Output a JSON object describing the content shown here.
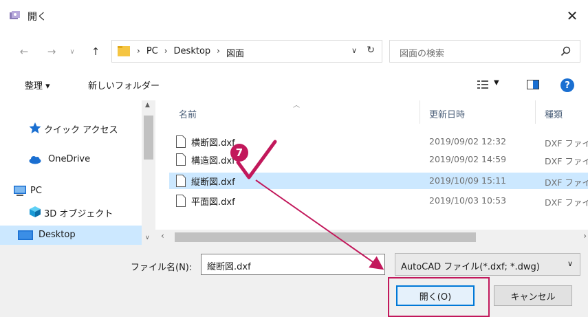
{
  "window": {
    "title": "開く"
  },
  "address": {
    "crumbs": [
      "PC",
      "Desktop",
      "図面"
    ],
    "search_placeholder": "図面の検索"
  },
  "toolbar": {
    "organize": "整理 ▾",
    "new_folder": "新しいフォルダー"
  },
  "sidebar": {
    "items": [
      {
        "label": "クイック アクセス",
        "icon": "star-icon"
      },
      {
        "label": "OneDrive",
        "icon": "cloud-icon"
      },
      {
        "label": "PC",
        "icon": "computer-icon"
      },
      {
        "label": "3D オブジェクト",
        "icon": "cube-icon"
      },
      {
        "label": "Desktop",
        "icon": "desktop-icon",
        "selected": true
      }
    ]
  },
  "columns": {
    "name": "名前",
    "date": "更新日時",
    "type": "種類"
  },
  "files": [
    {
      "name": "横断図.dxf",
      "date": "2019/09/02 12:32",
      "type": "DXF ファイル"
    },
    {
      "name": "構造図.dxf",
      "date": "2019/09/02 14:59",
      "type": "DXF ファイル"
    },
    {
      "name": "縦断図.dxf",
      "date": "2019/10/09 15:11",
      "type": "DXF ファイル",
      "selected": true
    },
    {
      "name": "平面図.dxf",
      "date": "2019/10/03 10:53",
      "type": "DXF ファイル"
    }
  ],
  "bottom": {
    "filename_label": "ファイル名(N):",
    "filename_value": "縦断図.dxf",
    "filetype_value": "AutoCAD ファイル(*.dxf; *.dwg)",
    "open_label": "開く(O)",
    "cancel_label": "キャンセル"
  },
  "annotation": {
    "step_number": "7",
    "color": "#c2185b"
  },
  "colors": {
    "selection": "#cce8ff",
    "accent": "#0078d7",
    "help": "#1a6fd1",
    "folder": "#f5c542"
  }
}
